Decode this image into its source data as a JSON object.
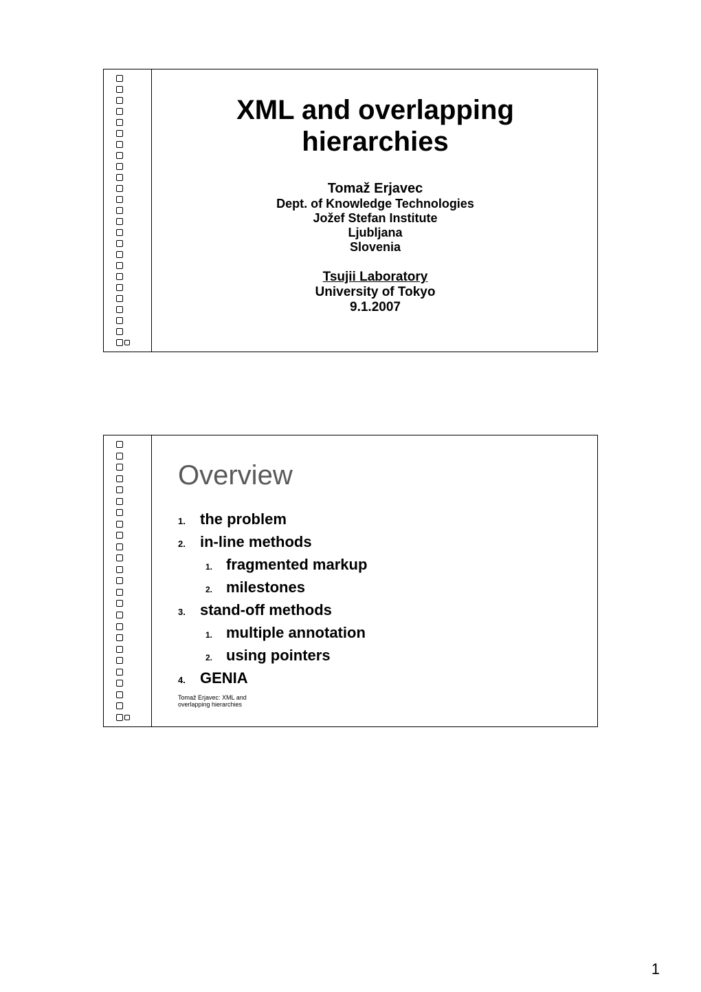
{
  "slide1": {
    "title_line1": "XML and overlapping",
    "title_line2": "hierarchies",
    "author": "Tomaž Erjavec",
    "dept": "Dept. of Knowledge Technologies",
    "institute": "Jožef Stefan Institute",
    "city": "Ljubljana",
    "country": "Slovenia",
    "lab": "Tsujii Laboratory",
    "university": "University of Tokyo",
    "date": "9.1.2007"
  },
  "slide2": {
    "title": "Overview",
    "items": [
      {
        "n": "1.",
        "text": "the problem"
      },
      {
        "n": "2.",
        "text": "in-line methods"
      },
      {
        "n": "1.",
        "text": "fragmented markup",
        "sub": true
      },
      {
        "n": "2.",
        "text": "milestones",
        "sub": true
      },
      {
        "n": "3.",
        "text": "stand-off methods"
      },
      {
        "n": "1.",
        "text": "multiple annotation",
        "sub": true
      },
      {
        "n": "2.",
        "text": "using pointers",
        "sub": true
      },
      {
        "n": "4.",
        "text": "GENIA"
      }
    ],
    "footer1": "Tomaž Erjavec:  XML and",
    "footer2": "overlapping hierarchies"
  },
  "page_number": "1"
}
